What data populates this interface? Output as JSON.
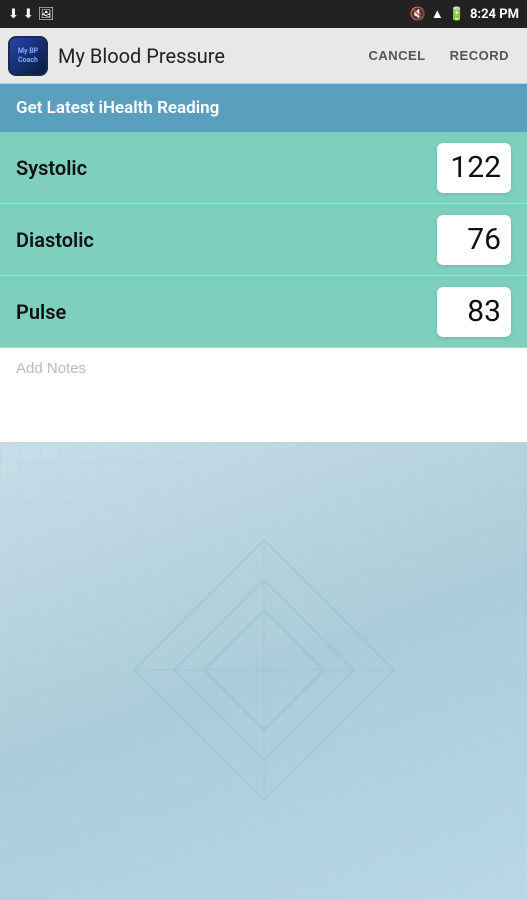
{
  "status_bar": {
    "time": "8:24 PM",
    "battery_icon": "🔋",
    "wifi_icon": "📶"
  },
  "app_bar": {
    "title": "My Blood Pressure",
    "icon_text": "My BP\nCoach",
    "cancel_label": "CANCEL",
    "record_label": "RECORD"
  },
  "ihealth": {
    "header": "Get Latest iHealth Reading"
  },
  "readings": [
    {
      "id": "systolic",
      "label": "Systolic",
      "value": "122"
    },
    {
      "id": "diastolic",
      "label": "Diastolic",
      "value": "76"
    },
    {
      "id": "pulse",
      "label": "Pulse",
      "value": "83"
    }
  ],
  "notes": {
    "placeholder": "Add Notes"
  }
}
